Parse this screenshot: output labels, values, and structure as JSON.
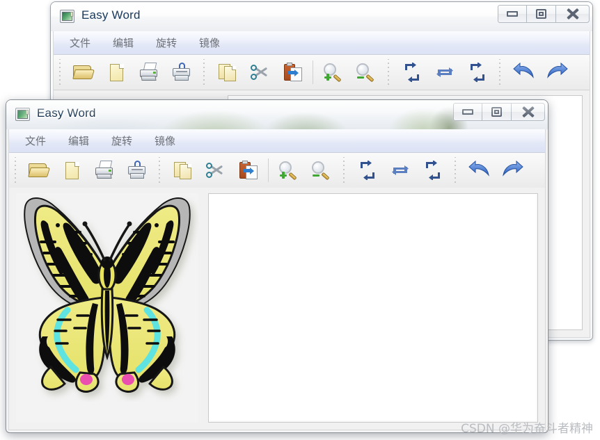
{
  "windows": {
    "back": {
      "title": "Easy Word",
      "app_icon": "image-window-icon",
      "controls": {
        "minimize": "Minimize",
        "restore": "Restore",
        "close": "Close"
      }
    },
    "front": {
      "title": "Easy Word",
      "app_icon": "image-window-icon",
      "controls": {
        "minimize": "Minimize",
        "restore": "Restore",
        "close": "Close"
      }
    }
  },
  "menu": {
    "items": [
      {
        "label": "文件",
        "name": "menu-file"
      },
      {
        "label": "编辑",
        "name": "menu-edit"
      },
      {
        "label": "旋转",
        "name": "menu-rotate"
      },
      {
        "label": "镜像",
        "name": "menu-mirror"
      }
    ]
  },
  "toolbar": {
    "groups": [
      {
        "buttons": [
          {
            "name": "open-file-button",
            "icon": "folder-open-icon",
            "tooltip": "打开"
          },
          {
            "name": "new-file-button",
            "icon": "blank-page-icon",
            "tooltip": "新建"
          },
          {
            "name": "print-button",
            "icon": "printer-icon",
            "tooltip": "打印"
          },
          {
            "name": "secure-print-button",
            "icon": "secure-printer-icon",
            "tooltip": "安全打印"
          }
        ]
      },
      {
        "buttons": [
          {
            "name": "copy-button",
            "icon": "copy-pages-icon",
            "tooltip": "复制"
          },
          {
            "name": "cut-button",
            "icon": "scissors-icon",
            "tooltip": "剪切"
          },
          {
            "name": "paste-button",
            "icon": "paste-clipboard-icon",
            "tooltip": "粘贴"
          }
        ]
      },
      {
        "buttons": [
          {
            "name": "zoom-in-button",
            "icon": "magnifier-plus-icon",
            "tooltip": "放大"
          },
          {
            "name": "zoom-out-button",
            "icon": "magnifier-minus-icon",
            "tooltip": "缩小"
          }
        ]
      },
      {
        "buttons": [
          {
            "name": "rotate-left-button",
            "icon": "rotate-vertical-icon",
            "tooltip": "垂直翻转"
          },
          {
            "name": "rotate-refresh-button",
            "icon": "rotate-horizontal-icon",
            "tooltip": "水平翻转"
          },
          {
            "name": "rotate-right-button",
            "icon": "rotate-vertical-alt-icon",
            "tooltip": "旋转"
          }
        ]
      },
      {
        "buttons": [
          {
            "name": "undo-button",
            "icon": "undo-arrow-icon",
            "tooltip": "撤销"
          },
          {
            "name": "redo-button",
            "icon": "redo-arrow-icon",
            "tooltip": "恢复"
          }
        ]
      }
    ]
  },
  "image_pane": {
    "name": "butterfly-image",
    "description": "swallowtail-butterfly",
    "colors": {
      "wing": "#ece97a",
      "pattern": "#111111",
      "band": "#5fe3e0",
      "spot": "#ea4fb0",
      "edge": "#b6b6b6"
    }
  },
  "canvas": {
    "name": "document-canvas",
    "content": "",
    "background": "#ffffff"
  },
  "watermark": {
    "text": "CSDN @华为奋斗者精神"
  }
}
